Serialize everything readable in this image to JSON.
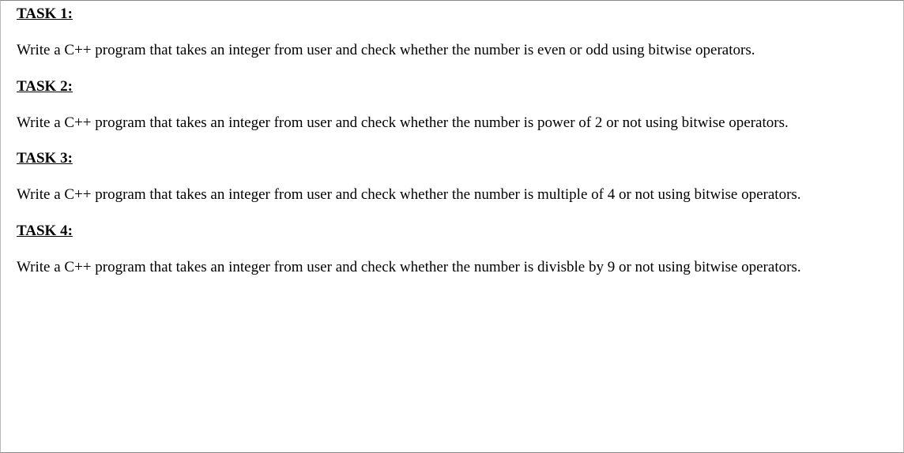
{
  "tasks": [
    {
      "heading": "TASK 1:",
      "body": "Write a C++ program that takes an integer from user and check whether the number is even or odd using bitwise operators."
    },
    {
      "heading": "TASK 2:",
      "body": "Write a C++ program that takes an integer from user and check whether the number is power of 2 or not using bitwise operators."
    },
    {
      "heading": "TASK 3:",
      "body": "Write a C++ program that takes an integer from user and check whether the number is multiple of 4 or not using bitwise operators."
    },
    {
      "heading": "TASK 4:",
      "body": "Write a C++ program that takes an integer from user and check whether the number is divisble by 9 or not using bitwise operators."
    }
  ]
}
